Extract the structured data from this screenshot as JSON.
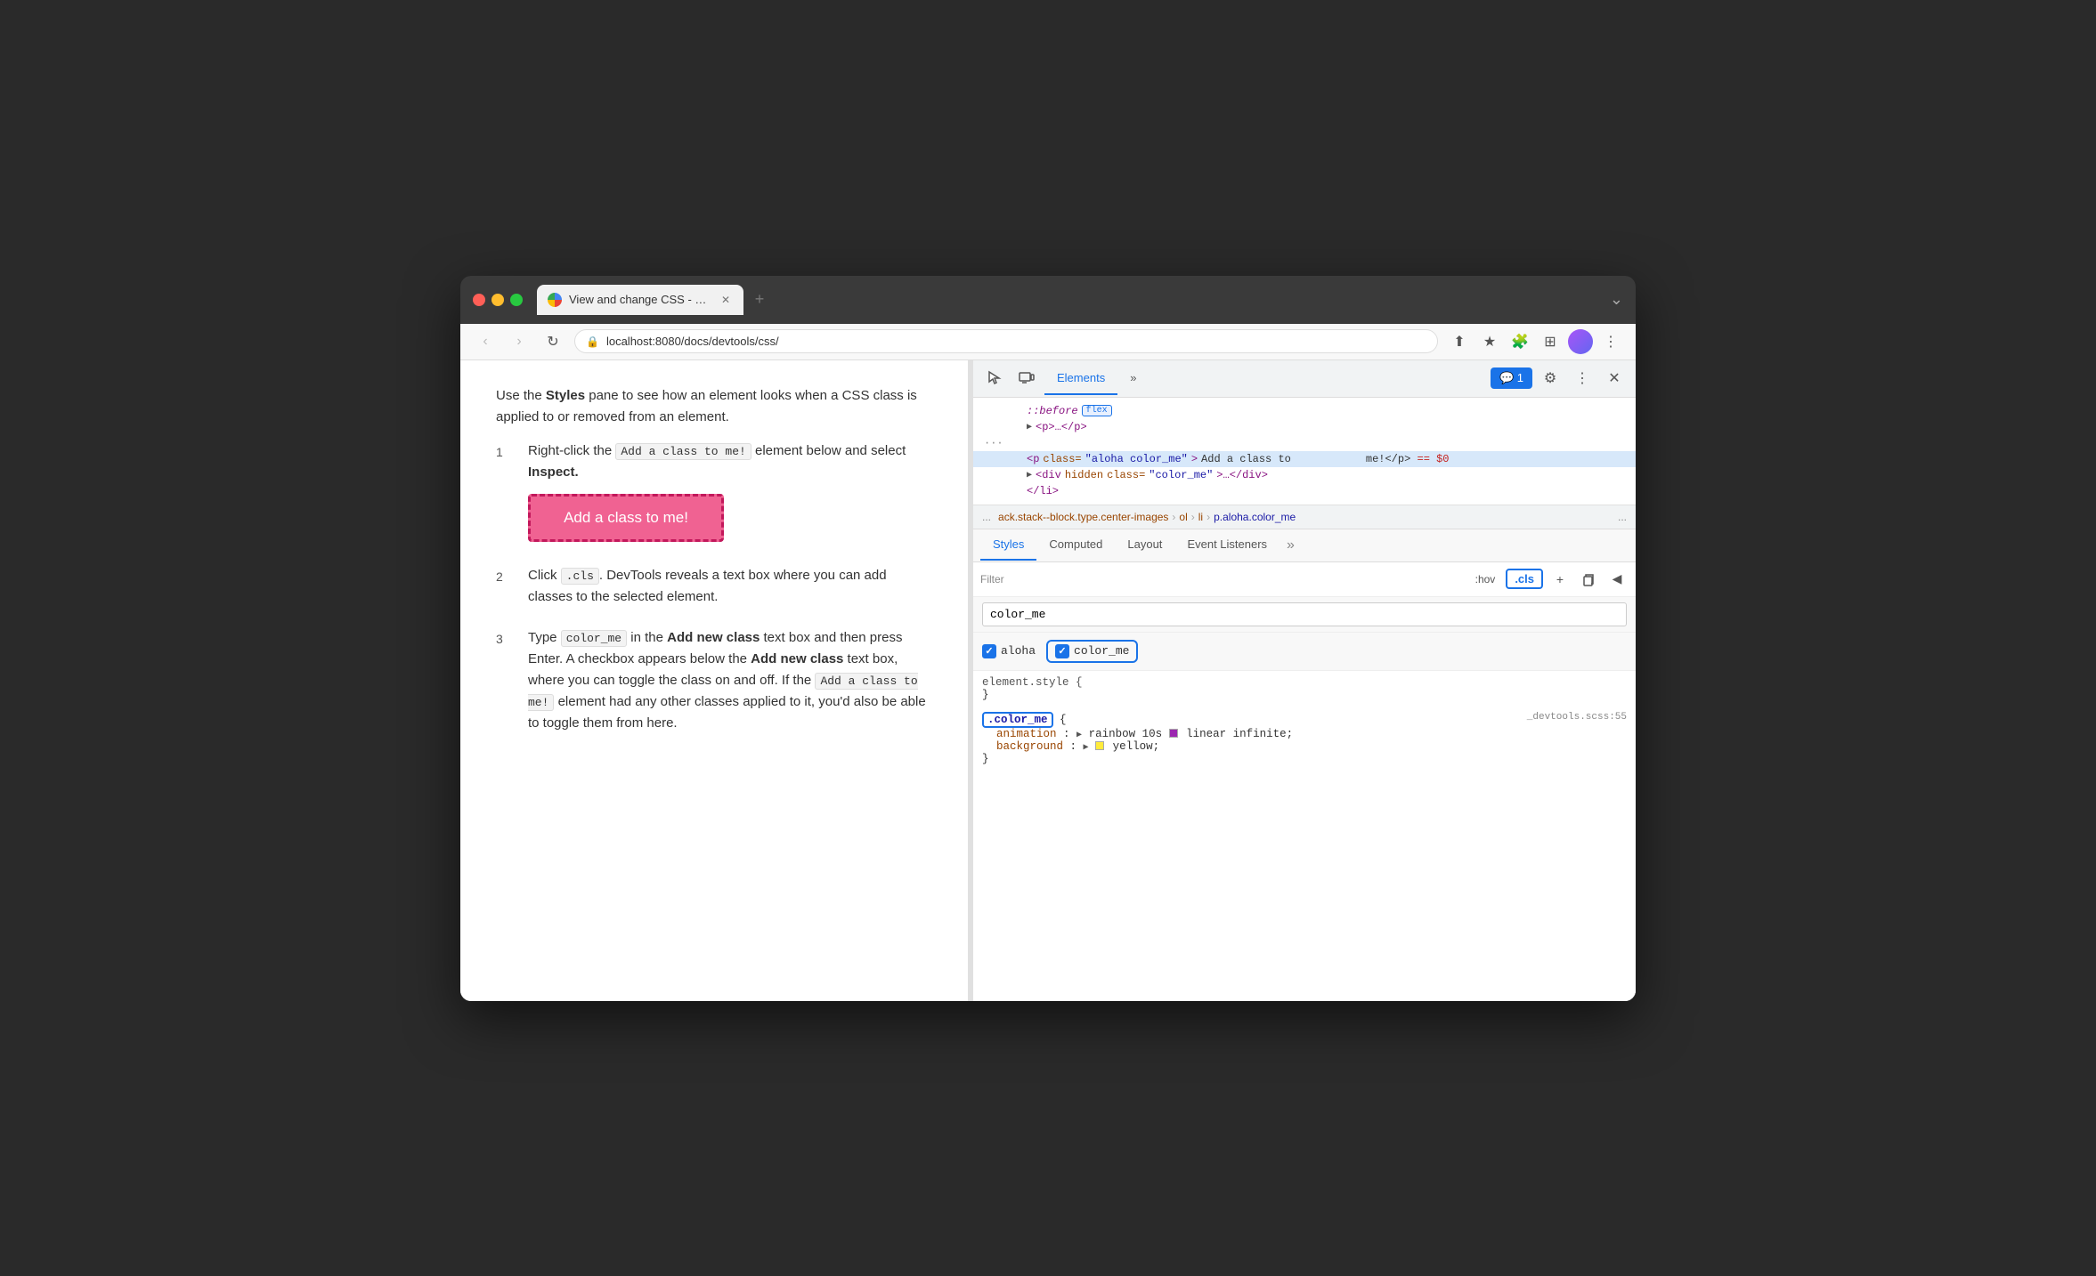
{
  "browser": {
    "tab_title": "View and change CSS - Chrom",
    "url": "localhost:8080/docs/devtools/css/",
    "new_tab_label": "+",
    "chevron_label": "⌄"
  },
  "doc": {
    "intro": "Use the ",
    "intro_bold": "Styles",
    "intro_rest": " pane to see how an element looks when a CSS class is applied to or removed from an element.",
    "steps": [
      {
        "number": "1",
        "text_before": "Right-click the ",
        "code": "Add a class to me!",
        "text_after": " element below and select ",
        "bold": "Inspect.",
        "has_button": true,
        "button_label": "Add a class to me!"
      },
      {
        "number": "2",
        "text_before": "Click ",
        "code": ".cls",
        "text_after": ". DevTools reveals a text box where you can add classes to the selected element."
      },
      {
        "number": "3",
        "text_before": "Type ",
        "code": "color_me",
        "text_middle": " in the ",
        "bold_mid": "Add new class",
        "text_mid2": " text box and then press Enter. A checkbox appears below the ",
        "bold_mid2": "Add new class",
        "text_end": " text box, where you can toggle the class on and off. If the ",
        "code2": "Add a class to me!",
        "text_end2": " element had any other classes applied to it, you'd also be able to toggle them from here."
      }
    ]
  },
  "devtools": {
    "header": {
      "inspect_label": "⌖",
      "device_label": "⊡",
      "elements_tab": "Elements",
      "more_tabs": "»",
      "chat_badge": "💬 1",
      "settings_label": "⚙",
      "more_label": "⋮",
      "close_label": "✕"
    },
    "dom": {
      "lines": [
        {
          "indent": 2,
          "content": "::before",
          "extra": "flex",
          "selected": false
        },
        {
          "indent": 2,
          "content": "<p>…</p>",
          "selected": false,
          "has_arrow": true
        },
        {
          "indent": 1,
          "is_dots": true
        },
        {
          "indent": 2,
          "content_html": true,
          "selected": true
        },
        {
          "indent": 2,
          "content": "<div hidden class=\"color_me\">…</div>",
          "selected": false,
          "has_arrow": true
        },
        {
          "indent": 2,
          "content": "</li>",
          "selected": false
        }
      ]
    },
    "breadcrumb": {
      "dots": "...",
      "items": [
        "ack.stack--block.type.center-images",
        "ol",
        "li",
        "p.aloha.color_me"
      ],
      "more": "..."
    },
    "styles_tabs": [
      "Styles",
      "Computed",
      "Layout",
      "Event Listeners",
      "»"
    ],
    "active_styles_tab": "Styles",
    "filter_placeholder": "Filter",
    "hov_label": ":hov",
    "cls_label": ".cls",
    "class_input_value": "color_me",
    "classes": [
      {
        "name": "aloha",
        "checked": true,
        "highlighted": false
      },
      {
        "name": "color_me",
        "checked": true,
        "highlighted": true
      }
    ],
    "css_rules": [
      {
        "selector": "element.style",
        "is_element_style": true,
        "properties": [],
        "file": ""
      },
      {
        "selector": ".color_me",
        "highlighted": true,
        "file": "_devtools.scss:55",
        "properties": [
          {
            "name": "animation",
            "colon": ":",
            "value": "▶ rainbow 10s",
            "color": "#9c27b0",
            "value2": "linear infinite;"
          },
          {
            "name": "background",
            "colon": ":",
            "value": "▶",
            "color": "#ffeb3b",
            "value2": "yellow;"
          }
        ]
      }
    ]
  }
}
